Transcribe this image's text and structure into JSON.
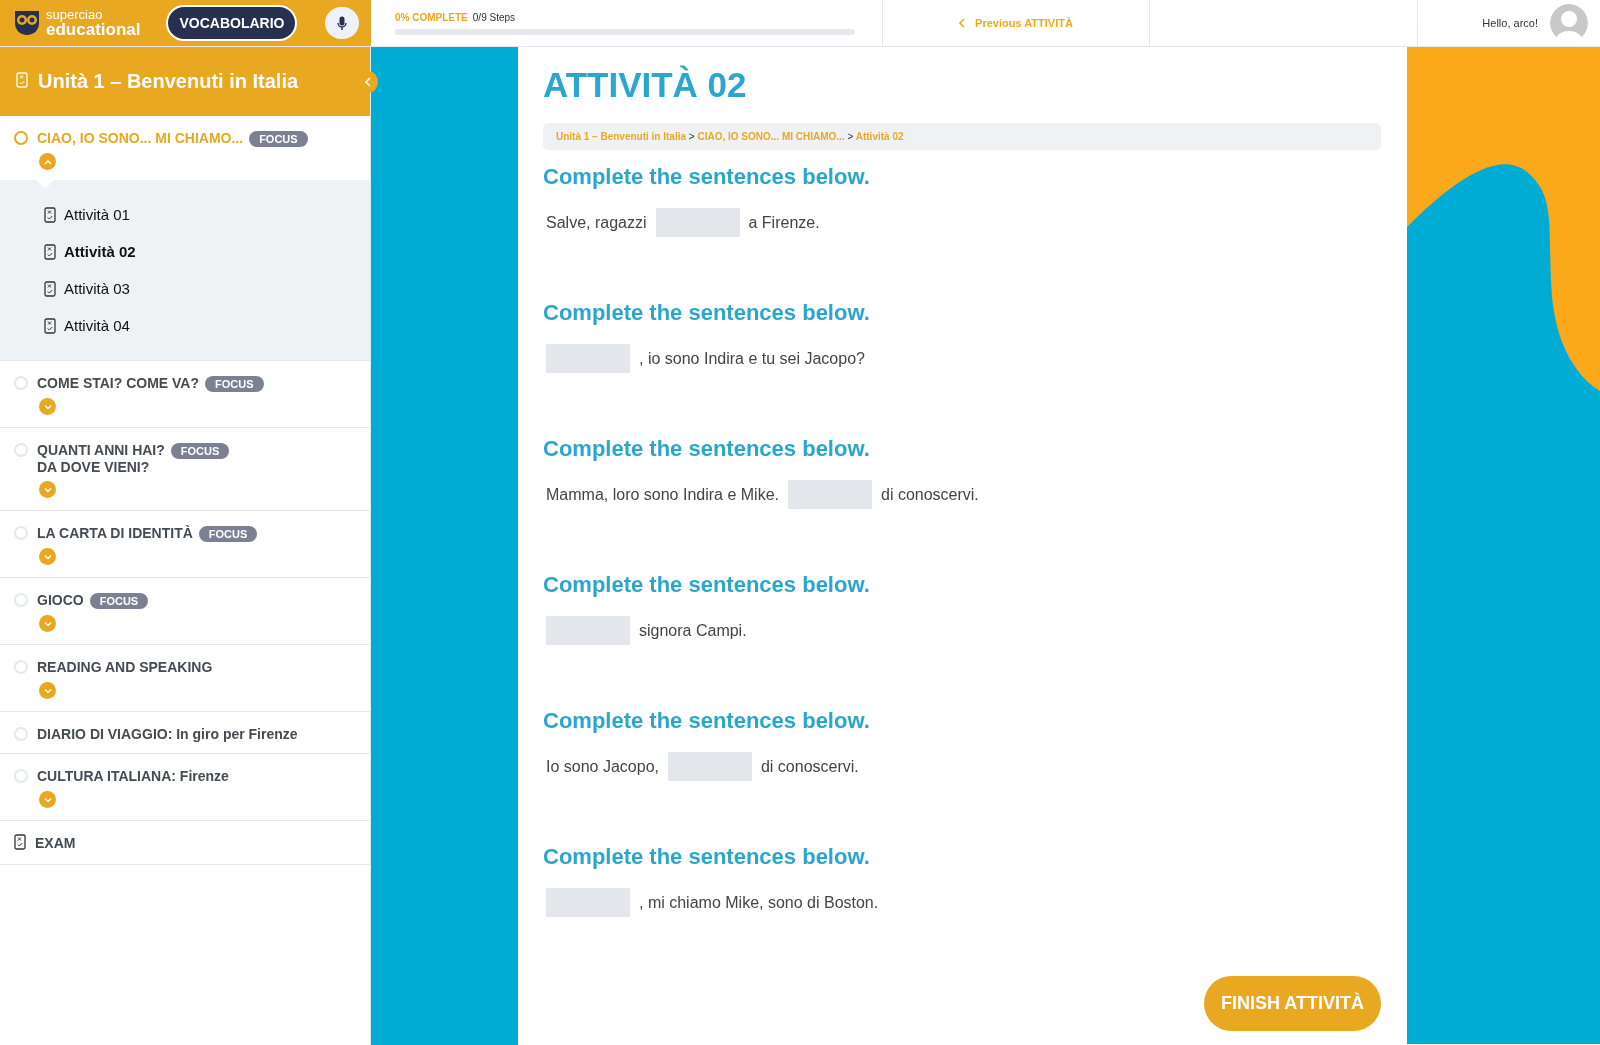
{
  "topbar": {
    "logo": {
      "line1": "superciao",
      "line2": "educational"
    },
    "vocab_button": "VOCABOLARIO",
    "progress": {
      "label": "0% COMPLETE",
      "steps": "0/9 Steps",
      "level": 0
    },
    "previous_link": "Previous ATTIVITÀ",
    "greeting": "Hello, arco!"
  },
  "sidebar": {
    "title": "Unità 1 – Benvenuti in Italia",
    "sections": [
      {
        "kind": "section",
        "title": "CIAO, IO SONO... MI CHIAMO...",
        "badge": "FOCUS",
        "current": true,
        "expanded": true,
        "children": [
          {
            "label": "Attività 01",
            "selected": false
          },
          {
            "label": "Attività 02",
            "selected": true
          },
          {
            "label": "Attività 03",
            "selected": false
          },
          {
            "label": "Attività 04",
            "selected": false
          }
        ]
      },
      {
        "kind": "section",
        "title": "COME STAI? COME VA?",
        "badge": "FOCUS",
        "current": false,
        "expanded": false
      },
      {
        "kind": "section",
        "title": "QUANTI ANNI HAI?",
        "subtitle": "DA DOVE VIENI?",
        "badge": "FOCUS",
        "current": false,
        "expanded": false
      },
      {
        "kind": "section",
        "title": "LA CARTA DI IDENTITÀ",
        "badge": "FOCUS",
        "current": false,
        "expanded": false
      },
      {
        "kind": "section",
        "title": "GIOCO",
        "badge": "FOCUS",
        "current": false,
        "expanded": false
      },
      {
        "kind": "section",
        "title": "READING AND SPEAKING",
        "current": false,
        "expanded": false
      },
      {
        "kind": "lesson",
        "title": "DIARIO DI VIAGGIO: In giro per Firenze",
        "current": false
      },
      {
        "kind": "section",
        "title": "CULTURA ITALIANA: Firenze",
        "current": false,
        "expanded": false
      },
      {
        "kind": "exam",
        "title": "EXAM"
      }
    ]
  },
  "content": {
    "title": "ATTIVITÀ 02",
    "breadcrumb": [
      "Unità 1 – Benvenuti in Italia",
      "CIAO, IO SONO... MI CHIAMO...",
      "Attività 02"
    ],
    "breadcrumb_separator": ">",
    "exercises": [
      {
        "instruction": "Complete the sentences below.",
        "before": "Salve, ragazzi",
        "after": "a Firenze."
      },
      {
        "instruction": "Complete the sentences below.",
        "after": ", io sono Indira e tu sei Jacopo?"
      },
      {
        "instruction": "Complete the sentences below.",
        "before": "Mamma, loro sono Indira e Mike.",
        "after": "di conoscervi."
      },
      {
        "instruction": "Complete the sentences below.",
        "after": "signora Campi."
      },
      {
        "instruction": "Complete the sentences below.",
        "before": "Io sono Jacopo,",
        "after": "di conoscervi."
      },
      {
        "instruction": "Complete the sentences below.",
        "after": ", mi chiamo Mike, sono di Boston."
      }
    ],
    "finish_button": "FINISH ATTIVITÀ"
  }
}
